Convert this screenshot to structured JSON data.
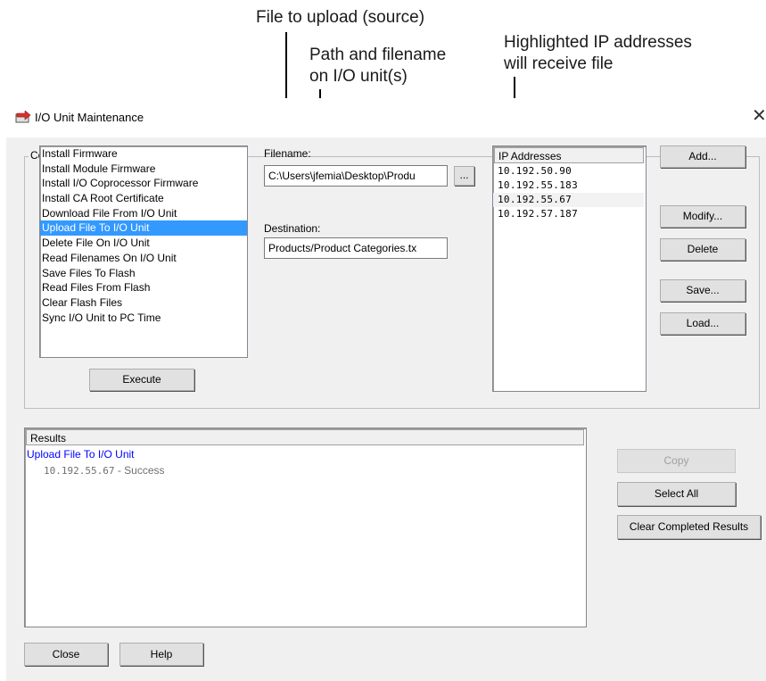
{
  "annotations": {
    "source": "File to upload (source)",
    "destination_line1": "Path and filename",
    "destination_line2": "on I/O unit(s)",
    "ips_line1": "Highlighted IP addresses",
    "ips_line2": "will receive file"
  },
  "window": {
    "title": "I/O Unit Maintenance",
    "close_glyph": "✕",
    "app_icon": "io-unit-icon"
  },
  "command_group": {
    "label": "Command",
    "items": [
      "Install Firmware",
      "Install Module Firmware",
      "Install I/O Coprocessor Firmware",
      "Install CA Root Certificate",
      "Download File From I/O Unit",
      "Upload File To I/O Unit",
      "Delete File On I/O Unit",
      "Read Filenames On I/O Unit",
      "Save Files To Flash",
      "Read Files From Flash",
      "Clear Flash Files",
      "Sync I/O Unit to PC Time"
    ],
    "selected_index": 5,
    "execute_label": "Execute"
  },
  "filename": {
    "label": "Filename:",
    "value": "C:\\Users\\jfemia\\Desktop\\Produ",
    "browse_label": "..."
  },
  "destination": {
    "label": "Destination:",
    "value": "Products/Product Categories.tx"
  },
  "ip_list": {
    "header": "IP Addresses",
    "items": [
      "10.192.50.90",
      "10.192.55.183",
      "10.192.55.67",
      "10.192.57.187"
    ],
    "highlighted_index": 2
  },
  "ip_buttons": {
    "add": "Add...",
    "modify": "Modify...",
    "delete": "Delete",
    "save": "Save...",
    "load": "Load..."
  },
  "results": {
    "header": "Results",
    "title": "Upload File To I/O Unit",
    "ip": "10.192.55.67",
    "status": " - Success"
  },
  "result_buttons": {
    "copy": "Copy",
    "select_all": "Select All",
    "clear_completed": "Clear Completed Results"
  },
  "footer": {
    "close": "Close",
    "help": "Help"
  },
  "colors": {
    "selection": "#3399ff",
    "result_title": "#0000ff",
    "window_bg": "#f0f0f0"
  }
}
